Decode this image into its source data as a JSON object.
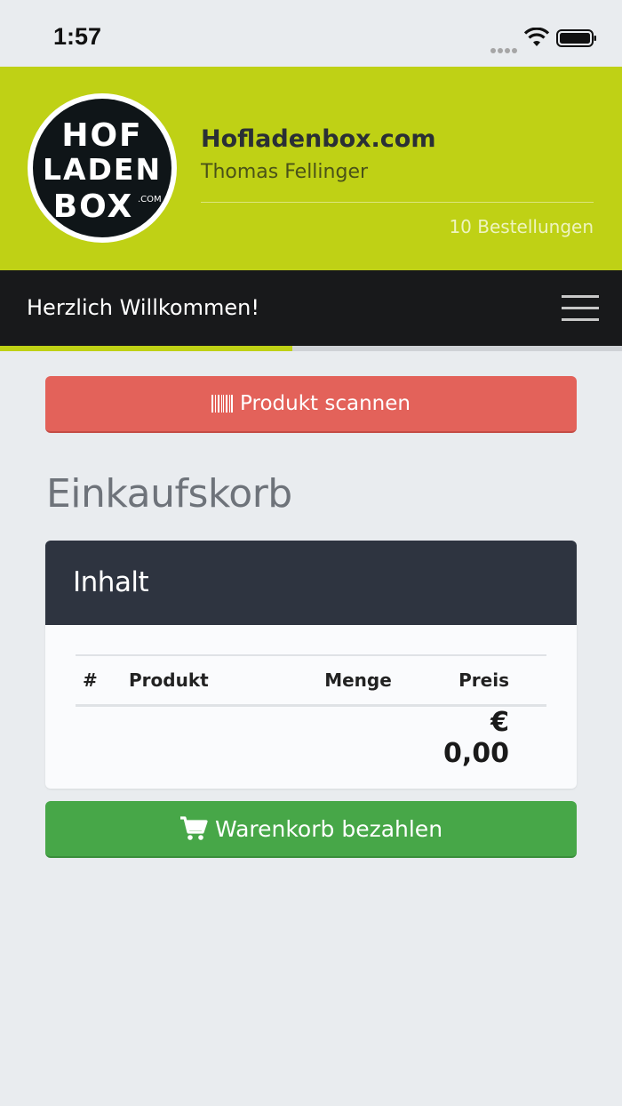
{
  "status_bar": {
    "time": "1:57",
    "icons": [
      "signal-icon",
      "wifi-icon",
      "battery-icon"
    ]
  },
  "header": {
    "logo": {
      "line1": "HOF",
      "line2": "LADEN",
      "line3": "BOX",
      "suffix": ".COM"
    },
    "shop_name": "Hofladenbox.com",
    "owner_name": "Thomas Fellinger",
    "orders": "10 Bestellungen"
  },
  "navbar": {
    "title": "Herzlich Willkommen!",
    "menu_icon": "hamburger-icon",
    "progress": 0.47
  },
  "main": {
    "scan_button": {
      "icon": "barcode-icon",
      "label": "Produkt scannen"
    },
    "section_title": "Einkaufskorb",
    "cart": {
      "header": "Inhalt",
      "columns": [
        "#",
        "Produkt",
        "Menge",
        "Preis"
      ],
      "total": "€ 0,00"
    },
    "pay_button": {
      "icon": "cart-icon",
      "label": "Warenkorb bezahlen"
    }
  },
  "colors": {
    "brand_green": "#bfd115",
    "navbar": "#18191b",
    "scan_red": "#e3625a",
    "pay_green": "#47a748",
    "card_header": "#2e3440"
  }
}
